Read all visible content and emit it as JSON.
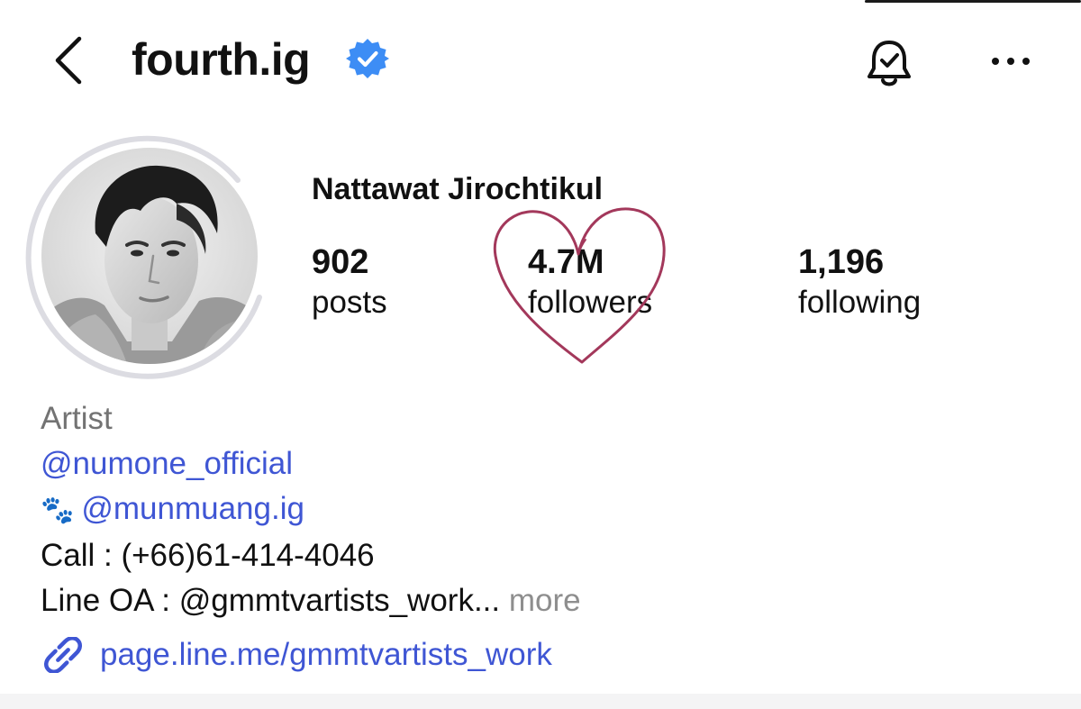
{
  "header": {
    "username": "fourth.ig",
    "icons": {
      "back": "chevron-left-icon",
      "verified": "verified-badge-icon",
      "notifications": "bell-check-icon",
      "more": "more-horizontal-icon"
    },
    "verified_color": "#3d8df5"
  },
  "profile": {
    "full_name": "Nattawat Jirochtikul",
    "stats": {
      "posts": {
        "value": "902",
        "label": "posts"
      },
      "followers": {
        "value": "4.7M",
        "label": "followers"
      },
      "following": {
        "value": "1,196",
        "label": "following"
      }
    },
    "avatar_ring_color": "#dcdce2",
    "doodle_color": "#a3385b"
  },
  "bio": {
    "category": "Artist",
    "mention_1": "@numone_official",
    "paw_emoji": "🐾",
    "mention_2": "@munmuang.ig",
    "call_line": "Call : (+66)61-414-4046",
    "line_oa": "Line OA : @gmmtvartists_work...",
    "more_label": "more",
    "link_icon": "link-icon",
    "link_text": "page.line.me/gmmtvartists_work",
    "link_color": "#3f56d4"
  }
}
